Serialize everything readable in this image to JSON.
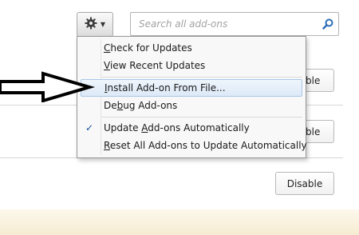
{
  "toolbar": {
    "gear_icon": "gear-icon",
    "search_placeholder": "Search all add-ons",
    "search_icon": "search-icon"
  },
  "addons": {
    "disable_label": "Disable",
    "disable_partial_1": "ble",
    "disable_partial_2": "ble"
  },
  "menu": {
    "check_updates": {
      "pre": "",
      "ul": "C",
      "post": "heck for Updates"
    },
    "view_recent": {
      "pre": "",
      "ul": "V",
      "post": "iew Recent Updates"
    },
    "install_file": {
      "pre": "",
      "ul": "I",
      "post": "nstall Add-on From File..."
    },
    "debug": {
      "pre": "De",
      "ul": "b",
      "post": "ug Add-ons"
    },
    "auto_update": {
      "pre": "Update ",
      "ul": "A",
      "post": "dd-ons Automatically",
      "checked": "✓"
    },
    "reset_all": {
      "pre": "",
      "ul": "R",
      "post": "eset All Add-ons to Update Automatically"
    }
  },
  "colors": {
    "highlight": "#dde9f7",
    "check": "#1a4fa0",
    "search_icon": "#2a6db5"
  }
}
